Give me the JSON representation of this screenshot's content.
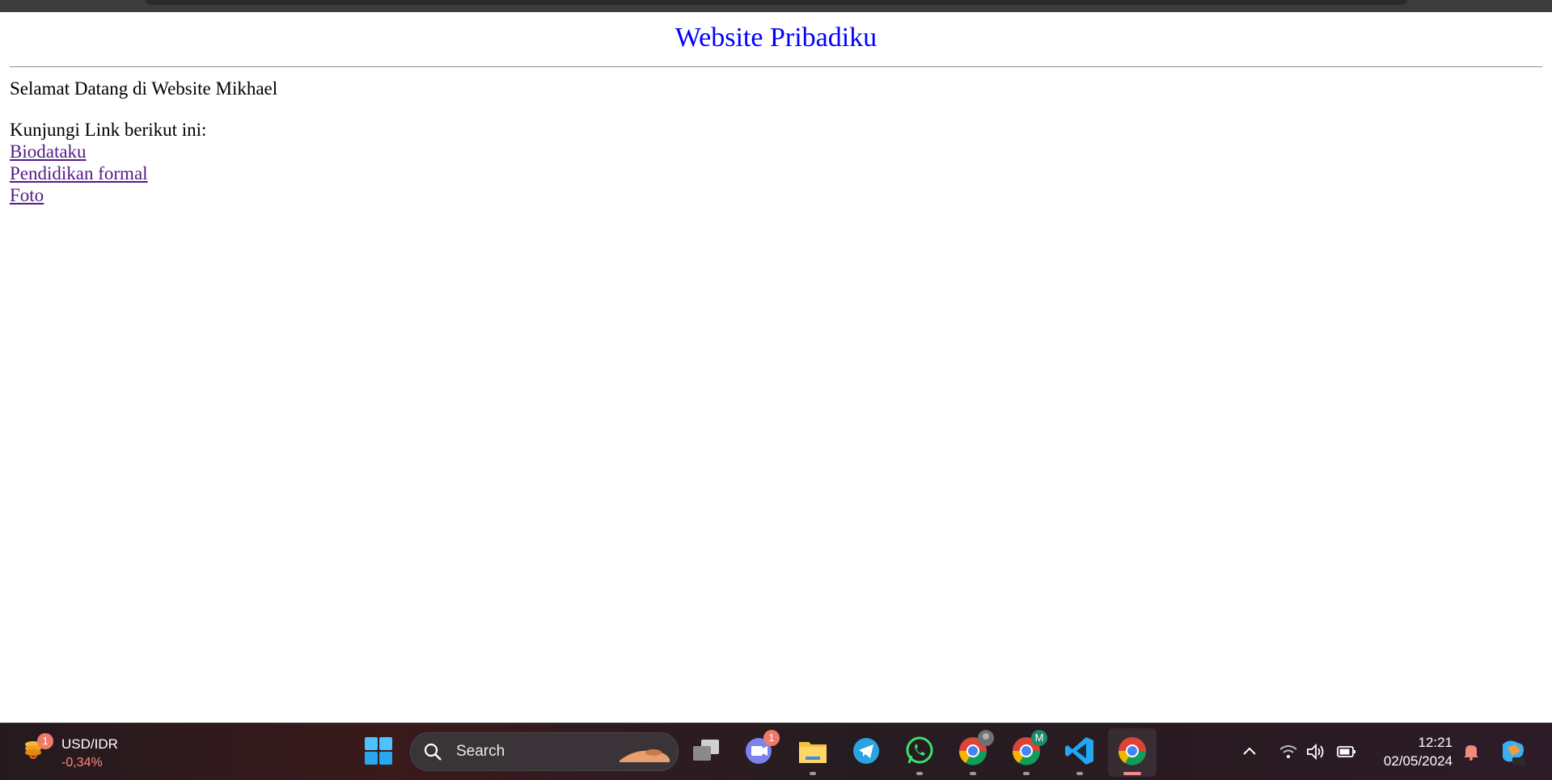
{
  "page": {
    "heading": "Website Pribadiku",
    "welcome": "Selamat Datang di Website Mikhael",
    "visit_intro": "Kunjungi Link berikut ini:",
    "links": [
      "Biodataku",
      "Pendidikan formal",
      "Foto"
    ],
    "heading_color": "#0000ff",
    "link_color": "#551a8b"
  },
  "taskbar": {
    "widget": {
      "badge": "1",
      "pair": "USD/IDR",
      "change": "-0,34%"
    },
    "search": {
      "label": "Search"
    },
    "app_badge_count": "1",
    "profile_badge": "M",
    "clock": {
      "time": "12:21",
      "date": "02/05/2024"
    },
    "apps": [
      "task-view",
      "teams",
      "file-explorer",
      "telegram",
      "whatsapp",
      "chrome",
      "chrome-profile",
      "vscode",
      "chrome-active"
    ]
  }
}
